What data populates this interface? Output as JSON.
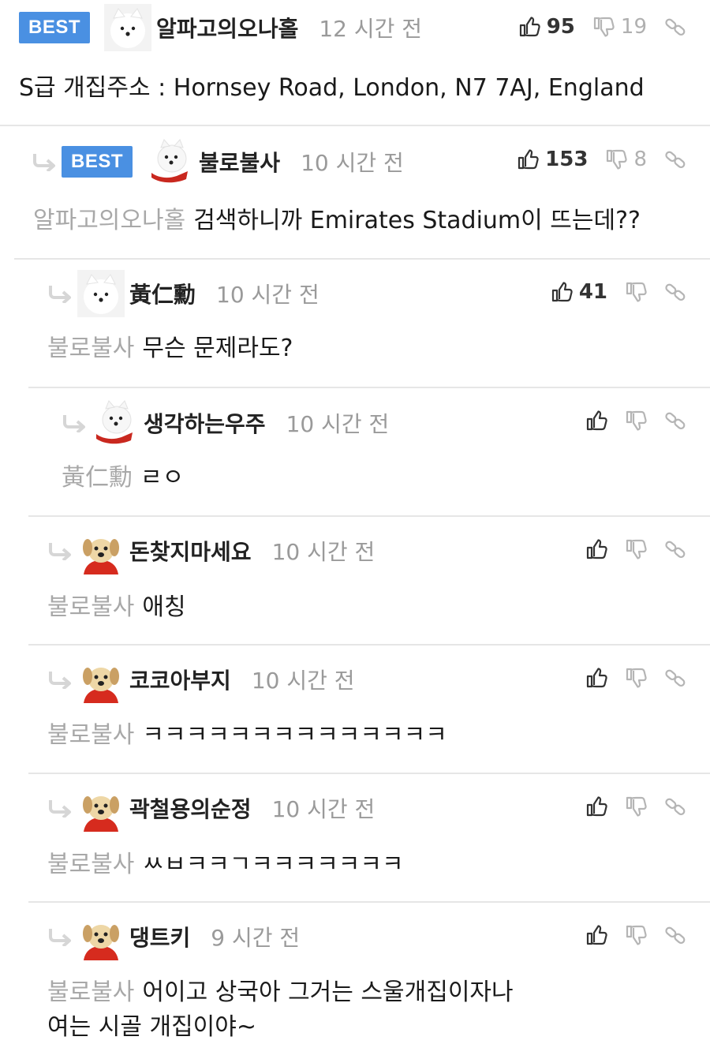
{
  "badge": "BEST",
  "comments": [
    {
      "nick": "알파고의오나홀",
      "time": "12 시간 전",
      "up": "95",
      "down": "19",
      "text": "S급 개집주소 : Hornsey Road, London, N7 7AJ, England",
      "mention": ""
    },
    {
      "nick": "불로불사",
      "time": "10 시간 전",
      "up": "153",
      "down": "8",
      "mention": "알파고의오나홀",
      "text": "검색하니까 Emirates Stadium이 뜨는데??"
    },
    {
      "nick": "黃仁勳",
      "time": "10 시간 전",
      "up": "41",
      "down": "",
      "mention": "불로불사",
      "text": "무슨 문제라도?"
    },
    {
      "nick": "생각하는우주",
      "time": "10 시간 전",
      "up": "",
      "down": "",
      "mention": "黃仁勳",
      "text": "ㄹㅇ"
    },
    {
      "nick": "돈찾지마세요",
      "time": "10 시간 전",
      "up": "",
      "down": "",
      "mention": "불로불사",
      "text": "애칭"
    },
    {
      "nick": "코코아부지",
      "time": "10 시간 전",
      "up": "",
      "down": "",
      "mention": "불로불사",
      "text": "ㅋㅋㅋㅋㅋㅋㅋㅋㅋㅋㅋㅋㅋㅋ"
    },
    {
      "nick": "곽철용의순정",
      "time": "10 시간 전",
      "up": "",
      "down": "",
      "mention": "불로불사",
      "text": "ㅆㅂㅋㅋㄱㅋㅋㅋㅋㅋㅋㅋ"
    },
    {
      "nick": "댕트키",
      "time": "9 시간 전",
      "up": "",
      "down": "",
      "mention": "불로불사",
      "text": "어이고 상국아 그거는 스울개집이자나",
      "text2": "여는 시골 개집이야~"
    }
  ],
  "colors": {
    "badge": "#4a90e2",
    "mention": "#a8a8a8",
    "time": "#9a9a9a"
  }
}
